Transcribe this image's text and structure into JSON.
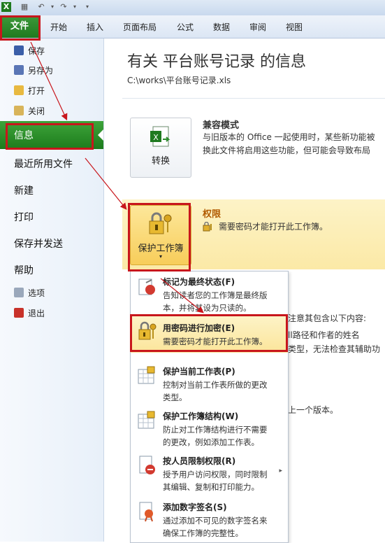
{
  "quick_access": {
    "app_icon": "excel-icon",
    "save_icon": "save-icon",
    "undo_icon": "undo-icon",
    "redo_icon": "redo-icon"
  },
  "ribbon": {
    "file_tab": "文件",
    "tabs": [
      "开始",
      "插入",
      "页面布局",
      "公式",
      "数据",
      "审阅",
      "视图"
    ]
  },
  "sidebar": {
    "small_items_top": [
      "保存",
      "另存为",
      "打开",
      "关闭"
    ],
    "info": "信息",
    "big_items": [
      "最近所用文件",
      "新建",
      "打印",
      "保存并发送",
      "帮助"
    ],
    "small_items_bottom": [
      "选项",
      "退出"
    ]
  },
  "main": {
    "title": "有关 平台账号记录 的信息",
    "path": "C:\\works\\平台账号记录.xls",
    "compat": {
      "button_label": "转换",
      "title": "兼容模式",
      "desc_line1": "与旧版本的 Office 一起使用时，某些新功能被",
      "desc_line2": "换此文件将启用这些功能，但可能会导致布局"
    },
    "permissions": {
      "button_label": "保护工作簿",
      "title": "权限",
      "desc": "需要密码才能打开此工作簿。"
    },
    "behind_text": {
      "line1": "注意其包含以下内容:",
      "line2": "ll路径和作者的姓名",
      "line3": "类型，无法检查其辅助功",
      "line4": "上一个版本。"
    }
  },
  "dropdown": {
    "items": [
      {
        "title": "标记为最终状态(F)",
        "desc1": "告知读者您的工作簿是最终版",
        "desc2": "本，并将其设为只读的。"
      },
      {
        "title": "用密码进行加密(E)",
        "desc1": "需要密码才能打开此工作簿。",
        "desc2": ""
      },
      {
        "title": "保护当前工作表(P)",
        "desc1": "控制对当前工作表所做的更改",
        "desc2": "类型。"
      },
      {
        "title": "保护工作簿结构(W)",
        "desc1": "防止对工作簿结构进行不需要",
        "desc2": "的更改，例如添加工作表。"
      },
      {
        "title": "按人员限制权限(R)",
        "desc1": "授予用户访问权限，同时限制",
        "desc2": "其编辑、复制和打印能力。"
      },
      {
        "title": "添加数字签名(S)",
        "desc1": "通过添加不可见的数字签名来",
        "desc2": "确保工作簿的完整性。"
      }
    ]
  },
  "colors": {
    "annotation_red": "#c8161c",
    "file_green": "#1f7a1f"
  }
}
